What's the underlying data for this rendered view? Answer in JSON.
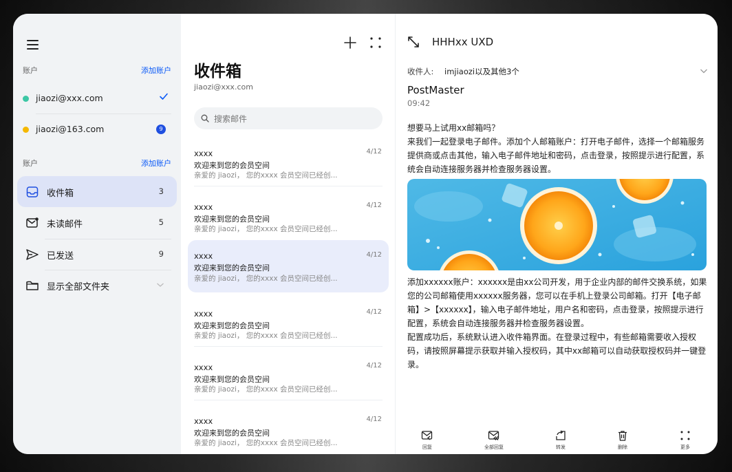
{
  "sidebar": {
    "accounts_header": {
      "label": "账户",
      "action": "添加账户"
    },
    "accounts": [
      {
        "address": "jiaozi@xxx.com",
        "color": "#3cc7a5",
        "checked": true
      },
      {
        "address": "jiaozi@163.com",
        "color": "#f5b800",
        "badge": "9"
      }
    ],
    "folders_header": {
      "label": "账户",
      "action": "添加账户"
    },
    "folders": [
      {
        "name": "收件箱",
        "count": "3",
        "icon": "inbox-icon",
        "active": true
      },
      {
        "name": "未读邮件",
        "count": "5",
        "icon": "unread-mail-icon"
      },
      {
        "name": "已发送",
        "count": "9",
        "icon": "send-icon"
      },
      {
        "name": "显示全部文件夹",
        "icon": "folder-icon",
        "expandable": true
      }
    ]
  },
  "list": {
    "title": "收件箱",
    "account": "jiaozi@xxx.com",
    "search_placeholder": "搜索邮件",
    "items": [
      {
        "from": "xxxx",
        "date": "4/12",
        "subject": "欢迎来到您的会员空间",
        "preview": "亲爱的 jiaozi，  您的xxxx 会员空间已经创..."
      },
      {
        "from": "xxxx",
        "date": "4/12",
        "subject": "欢迎来到您的会员空间",
        "preview": "亲爱的 jiaozi，  您的xxxx 会员空间已经创..."
      },
      {
        "from": "xxxx",
        "date": "4/12",
        "subject": "欢迎来到您的会员空间",
        "preview": "亲爱的 jiaozi，  您的xxxx 会员空间已经创...",
        "selected": true
      },
      {
        "from": "xxxx",
        "date": "4/12",
        "subject": "欢迎来到您的会员空间",
        "preview": "亲爱的 jiaozi，  您的xxxx 会员空间已经创..."
      },
      {
        "from": "xxxx",
        "date": "4/12",
        "subject": "欢迎来到您的会员空间",
        "preview": "亲爱的 jiaozi，  您的xxxx 会员空间已经创..."
      },
      {
        "from": "xxxx",
        "date": "4/12",
        "subject": "欢迎来到您的会员空间",
        "preview": "亲爱的 jiaozi，  您的xxxx 会员空间已经创..."
      }
    ]
  },
  "detail": {
    "title": "HHHxx UXD",
    "recipients_label": "收件人:",
    "recipients": "imjiaozi以及其他3个",
    "sender": "PostMaster",
    "time": "09:42",
    "paragraph1": "想要马上试用xx邮箱吗？\n来我们一起登录电子邮件。添加个人邮箱账户：打开电子邮件，选择一个邮箱服务提供商或点击其他，输入电子邮件地址和密码，点击登录，按照提示进行配置，系统会自动连接服务器并检查服务器设置。",
    "paragraph2": "添加xxxxxx账户：xxxxxx是由xx公司开发，用于企业内部的邮件交换系统，如果您的公司邮箱使用xxxxxx服务器，您可以在手机上登录公司邮箱。打开【电子邮箱】>【xxxxxx】，输入电子邮件地址，用户名和密码，点击登录，按照提示进行配置，系统会自动连接服务器并检查服务器设置。\n配置成功后，系统默认进入收件箱界面。在登录过程中，有些邮箱需要收入授权码，请按照屏幕提示获取并输入授权码，其中xx邮箱可以自动获取授权码并一键登录。",
    "toolbar": [
      {
        "label": "回复",
        "icon": "reply-icon"
      },
      {
        "label": "全部回复",
        "icon": "reply-all-icon"
      },
      {
        "label": "转发",
        "icon": "forward-icon"
      },
      {
        "label": "删除",
        "icon": "trash-icon"
      },
      {
        "label": "更多",
        "icon": "more-icon"
      }
    ]
  },
  "colors": {
    "accent": "#0a59f7",
    "active_folder": "#dde3f7",
    "selected_mail": "#e9edfb",
    "badge": "#1f4fe0"
  }
}
